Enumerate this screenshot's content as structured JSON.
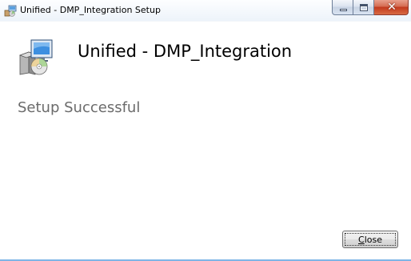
{
  "window": {
    "title": "Unified - DMP_Integration Setup",
    "caption_buttons": [
      {
        "name": "minimize",
        "icon": "minimize-icon"
      },
      {
        "name": "maximize",
        "icon": "maximize-icon"
      },
      {
        "name": "close",
        "icon": "close-icon",
        "color": "#c2391d"
      }
    ]
  },
  "header": {
    "product_name": "Unified - DMP_Integration",
    "icon": "installer-package-icon"
  },
  "main": {
    "status": "Setup Successful"
  },
  "footer": {
    "close_button": {
      "accel": "C",
      "rest": "lose"
    }
  }
}
